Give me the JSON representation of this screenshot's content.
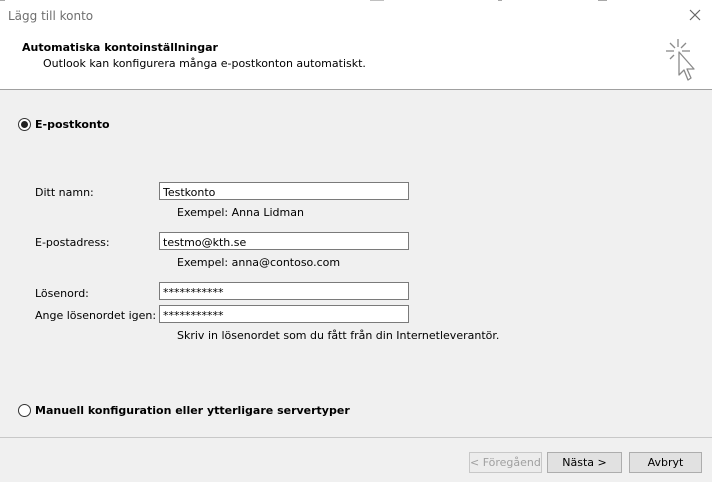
{
  "window": {
    "title": "Lägg till konto",
    "close_icon": "close-icon"
  },
  "header": {
    "title": "Automatiska kontoinställningar",
    "subtitle": "Outlook kan konfigurera många e-postkonton automatiskt.",
    "icon": "cursor-click-icon"
  },
  "options": {
    "email_account": {
      "label": "E-postkonto",
      "checked": true
    },
    "manual": {
      "label": "Manuell konfiguration eller ytterligare servertyper",
      "checked": false
    }
  },
  "form": {
    "name": {
      "label": "Ditt namn:",
      "value": "Testkonto",
      "hint": "Exempel: Anna Lidman"
    },
    "email": {
      "label": "E-postadress:",
      "value": "testmo@kth.se",
      "hint": "Exempel: anna@contoso.com"
    },
    "password": {
      "label": "Lösenord:",
      "value": "***********"
    },
    "password_confirm": {
      "label": "Ange lösenordet igen:",
      "value": "***********"
    },
    "password_hint": "Skriv in lösenordet som du fått från din Internetleverantör."
  },
  "buttons": {
    "back": "< Föregående",
    "next": "Nästa >",
    "cancel": "Avbryt"
  }
}
